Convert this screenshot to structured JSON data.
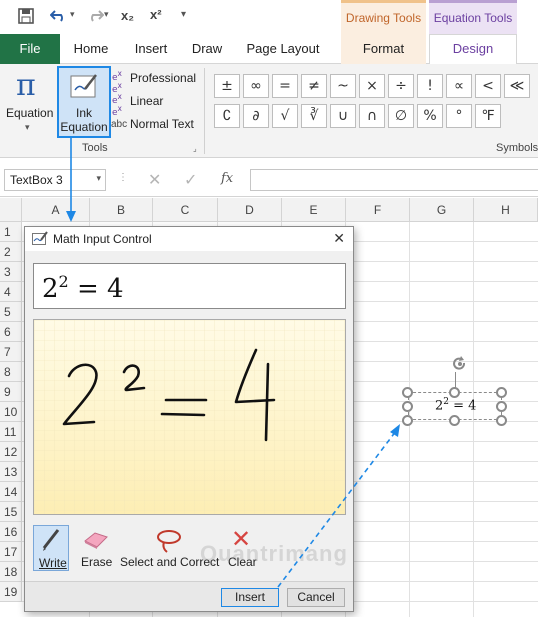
{
  "qat": {
    "save_icon": "save-icon",
    "undo_icon": "undo-icon",
    "redo_icon": "redo-icon",
    "sub_label": "x₂",
    "sup_label": "x²"
  },
  "context_tabs": {
    "drawing_tools": "Drawing Tools",
    "equation_tools": "Equation Tools"
  },
  "tabs": [
    "File",
    "Home",
    "Insert",
    "Draw",
    "Page Layout",
    "Format",
    "Design"
  ],
  "ribbon": {
    "equation_label": "Equation",
    "ink_label_1": "Ink",
    "ink_label_2": "Equation",
    "professional": "Professional",
    "linear": "Linear",
    "normal_text": "Normal Text",
    "abc": "abc",
    "tools_group": "Tools",
    "symbols_group": "Symbols",
    "symbols_row1": [
      "±",
      "∞",
      "=",
      "≠",
      "~",
      "×",
      "÷",
      "!",
      "∝",
      "<",
      "≪"
    ],
    "symbols_row2": [
      "∁",
      "∂",
      "√",
      "∛",
      "∪",
      "∩",
      "∅",
      "%",
      "°",
      "℉"
    ]
  },
  "formula_bar": {
    "name_box": "TextBox 3",
    "fx": "fx"
  },
  "columns": [
    "A",
    "B",
    "C",
    "D",
    "E",
    "F",
    "G",
    "H"
  ],
  "rows": [
    "1",
    "2",
    "3",
    "4",
    "5",
    "6",
    "7",
    "8",
    "9",
    "10",
    "11",
    "12",
    "13",
    "14",
    "15",
    "16",
    "17",
    "18",
    "19"
  ],
  "textbox": {
    "base": "2",
    "exp": "2",
    "rest": " = 4"
  },
  "dialog": {
    "title": "Math Input Control",
    "preview_base": "2",
    "preview_exp": "2",
    "preview_rest": " = 4",
    "tools": [
      "Write",
      "Erase",
      "Select and Correct",
      "Clear"
    ],
    "insert": "Insert",
    "cancel": "Cancel"
  },
  "watermark": "Quantrimang",
  "colors": {
    "excel_green": "#217346",
    "accent_blue": "#1e88e5",
    "equation_purple": "#6b3fa0"
  }
}
